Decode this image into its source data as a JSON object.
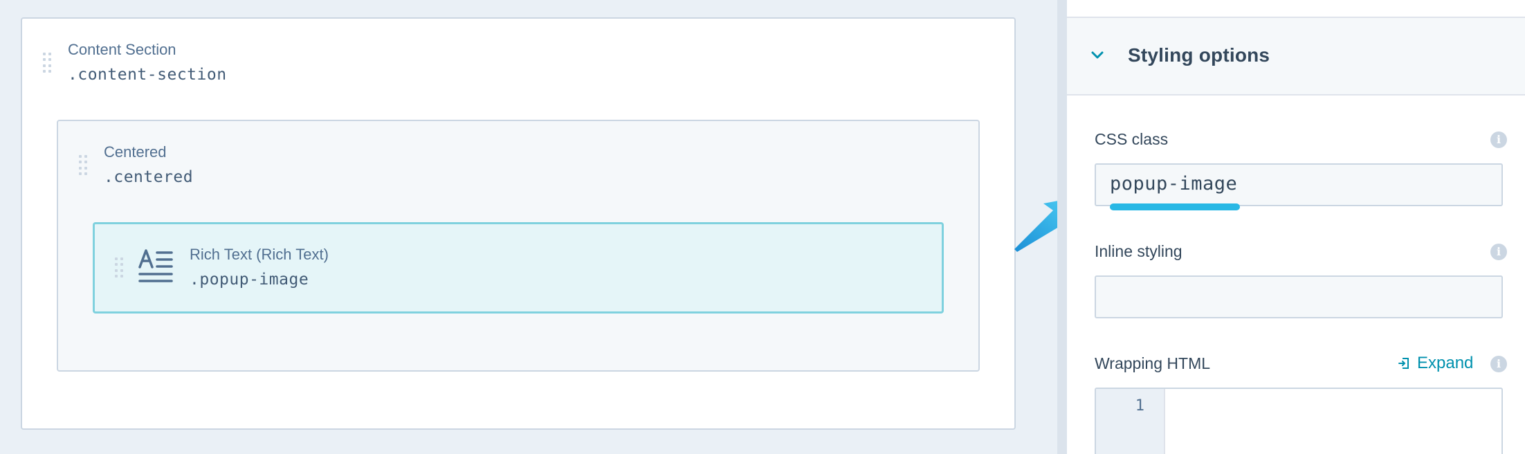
{
  "canvas": {
    "content_section": {
      "title": "Content Section",
      "css_class": ".content-section"
    },
    "centered": {
      "title": "Centered",
      "css_class": ".centered"
    },
    "rich_text": {
      "title": "Rich Text (Rich Text)",
      "css_class": ".popup-image",
      "icon": "rich-text-icon"
    }
  },
  "sidebar": {
    "section_title": "Styling options",
    "css_class": {
      "label": "CSS class",
      "value": "popup-image"
    },
    "inline_styling": {
      "label": "Inline styling",
      "value": ""
    },
    "wrapping_html": {
      "label": "Wrapping HTML",
      "expand_label": "Expand",
      "line_numbers": [
        "1"
      ]
    }
  },
  "colors": {
    "accent": "#0091ae",
    "highlight_border": "#7fd1de",
    "annotation_arrow": "#29b8e5"
  }
}
